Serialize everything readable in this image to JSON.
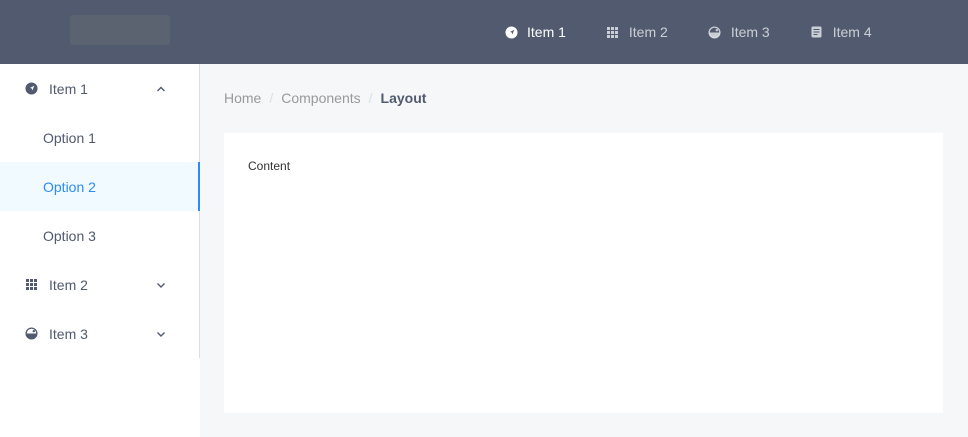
{
  "header": {
    "nav": [
      {
        "label": "Item 1",
        "icon": "navigate-icon",
        "active": true
      },
      {
        "label": "Item 2",
        "icon": "grid-icon",
        "active": false
      },
      {
        "label": "Item 3",
        "icon": "pie-icon",
        "active": false
      },
      {
        "label": "Item 4",
        "icon": "document-icon",
        "active": false
      }
    ]
  },
  "sidebar": {
    "groups": [
      {
        "label": "Item 1",
        "icon": "navigate-icon",
        "expanded": true,
        "options": [
          "Option 1",
          "Option 2",
          "Option 3"
        ],
        "active_option": "Option 2"
      },
      {
        "label": "Item 2",
        "icon": "grid-icon",
        "expanded": false
      },
      {
        "label": "Item 3",
        "icon": "pie-icon",
        "expanded": false
      }
    ]
  },
  "breadcrumb": {
    "items": [
      "Home",
      "Components",
      "Layout"
    ],
    "separator": "/"
  },
  "content": {
    "text": "Content"
  },
  "colors": {
    "header_bg": "#515a6e",
    "accent": "#2d8cf0",
    "page_bg": "#f5f7f9",
    "active_option_bg": "#f0faff"
  }
}
